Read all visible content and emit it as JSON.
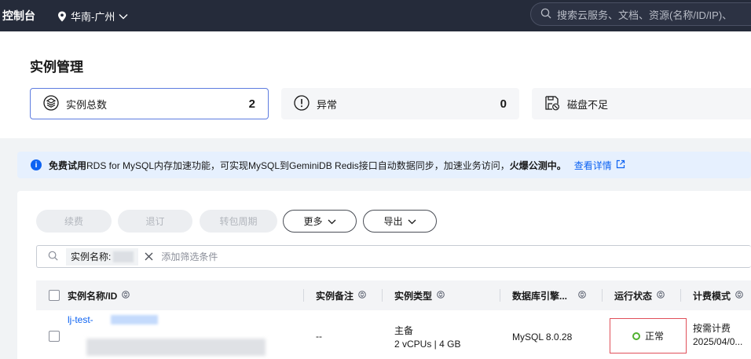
{
  "topbar": {
    "brand": "控制台",
    "region": "华南-广州",
    "search_placeholder": "搜索云服务、文档、资源(名称/ID/IP)、"
  },
  "page": {
    "title": "实例管理"
  },
  "stats": [
    {
      "label": "实例总数",
      "count": "2",
      "icon": "layers-icon"
    },
    {
      "label": "异常",
      "count": "0",
      "icon": "alert-circle-icon"
    },
    {
      "label": "磁盘不足",
      "count": "",
      "icon": "disk-warning-icon"
    }
  ],
  "notice": {
    "lead": "免费试用",
    "text": " RDS for MySQL内存加速功能，可实现MySQL到GeminiDB Redis接口自动数据同步，加速业务访问，",
    "hot": "火爆公测中。",
    "link": "查看详情"
  },
  "toolbar": {
    "renew": "续费",
    "unsubscribe": "退订",
    "to_monthly": "转包周期",
    "more": "更多",
    "export": "导出"
  },
  "filter": {
    "chip_label": "实例名称:",
    "placeholder": "添加筛选条件"
  },
  "table": {
    "headers": {
      "name": "实例名称/ID",
      "remark": "实例备注",
      "type": "实例类型",
      "engine": "数据库引擎...",
      "status": "运行状态",
      "billing": "计费模式"
    },
    "rows": [
      {
        "name": "lj-test-",
        "remark": "--",
        "type_role": "主备",
        "type_spec": "2 vCPUs | 4 GB",
        "engine": "MySQL 8.0.28",
        "status": "正常",
        "billing_mode": "按需计费",
        "billing_date": "2025/04/0..."
      }
    ]
  },
  "colors": {
    "topbar": "#252b3a",
    "accent": "#0c62f2",
    "status_ok": "#50b12f",
    "highlight_border": "#e0505a"
  }
}
